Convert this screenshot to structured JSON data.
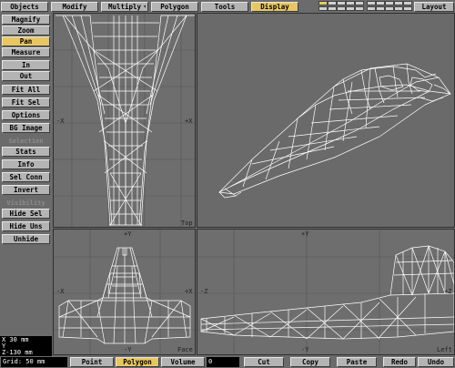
{
  "top_tabs": [
    {
      "label": "Objects",
      "active": false,
      "dropdown": false
    },
    {
      "label": "Modify",
      "active": false,
      "dropdown": false
    },
    {
      "label": "Multiply",
      "active": false,
      "dropdown": true
    },
    {
      "label": "Polygon",
      "active": false,
      "dropdown": false
    },
    {
      "label": "Tools",
      "active": false,
      "dropdown": false
    },
    {
      "label": "Display",
      "active": true,
      "dropdown": false
    }
  ],
  "layout_button": "Layout",
  "layer_grid": {
    "cells": 20,
    "active_index": 0
  },
  "sidebar": {
    "buttons_1": [
      "Magnify",
      "Zoom",
      "Pan",
      "Measure"
    ],
    "active_button": "Pan",
    "buttons_2": [
      "In",
      "Out",
      "Fit All",
      "Fit Sel",
      "Options",
      "BG Image"
    ],
    "section_selection": "Selection",
    "buttons_3": [
      "Stats",
      "Info",
      "Sel Conn",
      "Invert"
    ],
    "section_visibility": "Visibility",
    "buttons_4": [
      "Hide Sel",
      "Hide Uns",
      "Unhide"
    ]
  },
  "coords": {
    "x": "X 30 mm",
    "y": "Y",
    "z": "Z-130 mm"
  },
  "viewports": {
    "top": {
      "label": "Top",
      "axis_left": "-X",
      "axis_right": "+X"
    },
    "front": {
      "label": "Face",
      "axis_top": "+Y",
      "axis_bottom": "-Y",
      "axis_left": "-X",
      "axis_right": "+X"
    },
    "side": {
      "label": "Left",
      "axis_top": "+Y",
      "axis_bottom": "-Y",
      "axis_left": "-Z",
      "axis_right": "+Z"
    }
  },
  "bottom_bar": {
    "grid": "Grid: 50 mm",
    "modes": [
      "Point",
      "Polygon",
      "Volume"
    ],
    "active_mode": "Polygon",
    "volume_value": "0",
    "actions": [
      "Cut",
      "Copy",
      "Paste",
      "Redo",
      "Undo"
    ]
  },
  "colors": {
    "ui_gray": "#b4b4b4",
    "active_yellow": "#e8c763",
    "viewport_bg": "#6e6e6e",
    "wire": "#ffffff"
  }
}
